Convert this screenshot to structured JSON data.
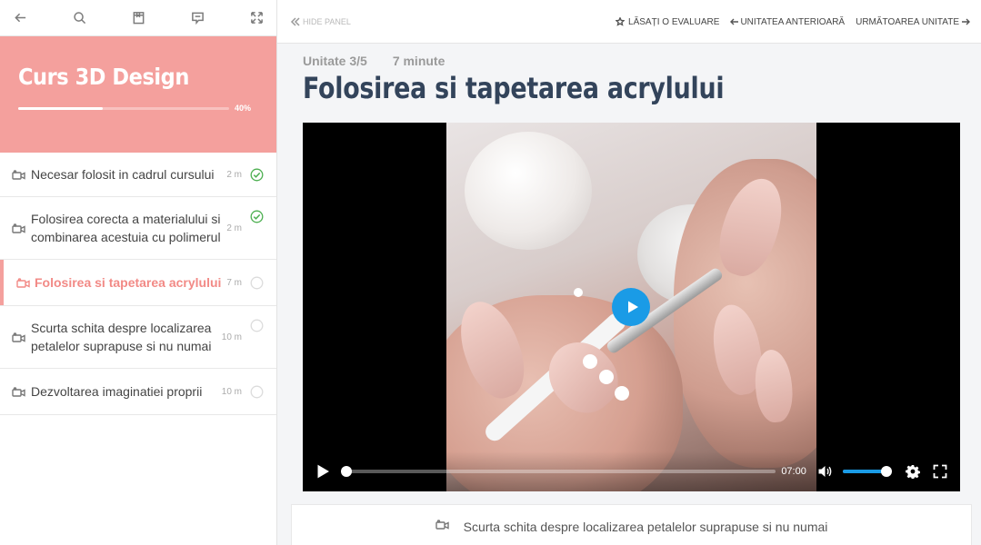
{
  "sidebar": {
    "toolbar": {
      "icons": [
        "arrow-left-icon",
        "search-icon",
        "bookmark-icon",
        "comment-icon",
        "fullscreen-icon"
      ]
    },
    "course": {
      "title": "Curs 3D Design",
      "progress_label": "40%",
      "progress": 0.4
    },
    "lessons": [
      {
        "title": "Necesar folosit in cadrul cursului",
        "duration": "2 m",
        "status": "completed"
      },
      {
        "title": "Folosirea corecta a materialului si combinarea acestuia cu polimerul",
        "duration": "2 m",
        "status": "completed"
      },
      {
        "title": "Folosirea si tapetarea acrylului",
        "duration": "7 m",
        "status": "current"
      },
      {
        "title": "Scurta schita despre localizarea petalelor suprapuse si nu numai",
        "duration": "10 m",
        "status": "pending"
      },
      {
        "title": "Dezvoltarea imaginatiei proprii",
        "duration": "10 m",
        "status": "pending"
      }
    ]
  },
  "topbar": {
    "hide_panel": "Hide panel",
    "review": "Lăsați o evaluare",
    "prev_unit": "Unitatea anterioară",
    "next_unit": "Următoarea unitate"
  },
  "unit": {
    "position": "Unitate 3/5",
    "duration": "7 minute",
    "title": "Folosirea si tapetarea acrylului"
  },
  "video": {
    "time": "07:00",
    "volume": 0.9,
    "played": 0
  },
  "next_lesson": {
    "title": "Scurta schita despre localizarea petalelor suprapuse si nu numai"
  },
  "colors": {
    "accent": "#f4a09d",
    "active_text": "#f28a86",
    "check": "#4caf50",
    "player_blue": "#1a9be6",
    "title": "#33445b"
  }
}
